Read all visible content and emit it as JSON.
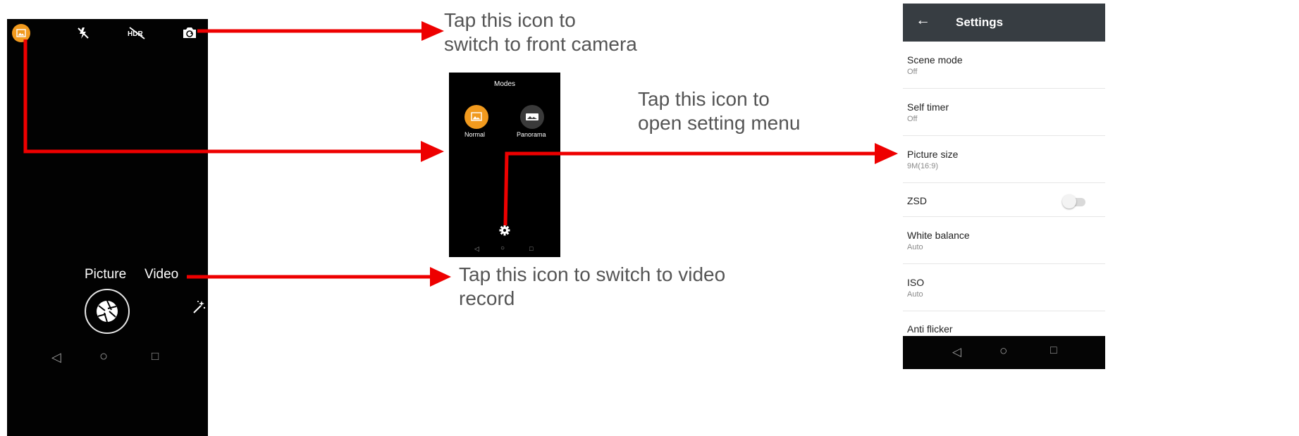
{
  "annotations": {
    "front_camera": [
      "Tap this icon to",
      "switch to front camera"
    ],
    "settings_menu": [
      "Tap this icon to",
      "open setting menu"
    ],
    "video_record": [
      "Tap this icon to switch to video",
      "record"
    ]
  },
  "camera_screen": {
    "top_icons": [
      "gallery-icon",
      "flash-off-icon",
      "hdr-off-icon",
      "switch-camera-icon"
    ],
    "modes": {
      "picture": "Picture",
      "video": "Video"
    },
    "shutter_icon": "aperture-icon",
    "effects_icon": "magic-wand-icon"
  },
  "modes_screen": {
    "title": "Modes",
    "modes": [
      {
        "label": "Normal",
        "icon": "image-icon",
        "color": "#f19a1e"
      },
      {
        "label": "Panorama",
        "icon": "panorama-icon",
        "color": "#3a3a3a"
      }
    ],
    "settings_icon": "gear-icon"
  },
  "settings_screen": {
    "title": "Settings",
    "back_icon": "arrow-back-icon",
    "items": [
      {
        "title": "Scene mode",
        "value": "Off"
      },
      {
        "title": "Self timer",
        "value": "Off"
      },
      {
        "title": "Picture size",
        "value": "9M(16:9)"
      },
      {
        "title": "ZSD",
        "value": "",
        "toggle": false
      },
      {
        "title": "White balance",
        "value": "Auto"
      },
      {
        "title": "ISO",
        "value": "Auto"
      },
      {
        "title": "Anti flicker",
        "value": ""
      }
    ]
  },
  "nav_bar": {
    "back": "◁",
    "home": "○",
    "recents": "□"
  },
  "colors": {
    "arrow": "#ee0000",
    "accent": "#f19a1e",
    "appbar": "#373d42"
  }
}
